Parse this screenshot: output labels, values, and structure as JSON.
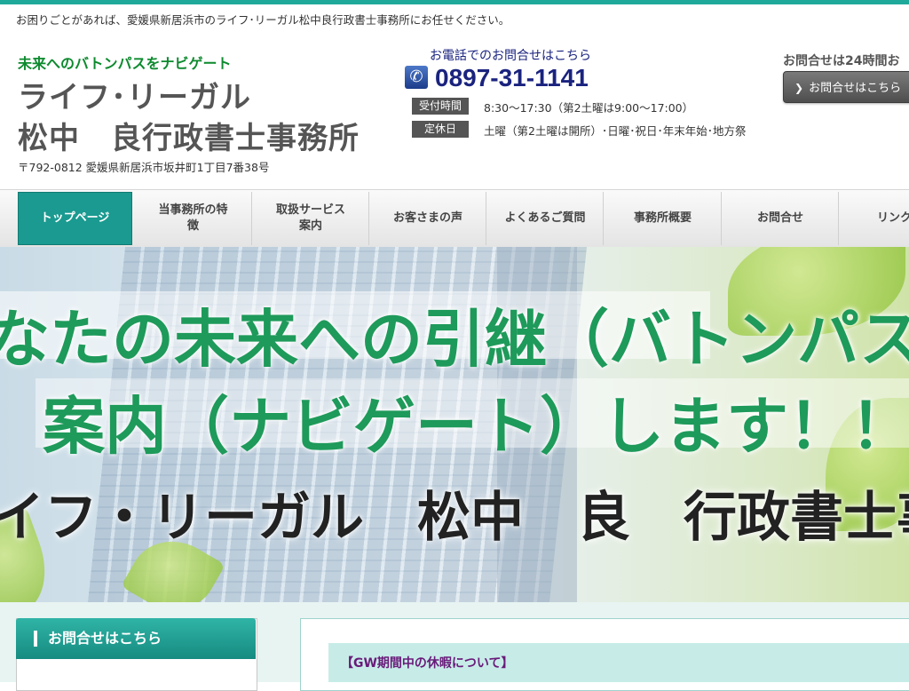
{
  "header": {
    "tagline": "お困りごとがあれば、愛媛県新居浜市のライフ･リーガル松中良行政書士事務所にお任せください。",
    "catchphrase": "未来へのバトンパスをナビゲート",
    "office_name_line1": "ライフ･リーガル",
    "office_name_line2": "松中　良行政書士事務所",
    "address": "〒792-0812 愛媛県新居浜市坂井町1丁目7番38号",
    "tel_caption": "お電話でのお問合せはこちら",
    "tel_number": "0897-31-1141",
    "hours_label": "受付時間",
    "hours_value": "8:30～17:30（第2土曜は9:00～17:00）",
    "closed_label": "定休日",
    "closed_value": "土曜（第2土曜は開所）･日曜･祝日･年末年始･地方祭",
    "contact_24_text": "お問合せは24時間お",
    "contact_button_label": "お問合せはこちら",
    "phone_icon": "phone-icon"
  },
  "nav": {
    "items": [
      {
        "label": "トップページ"
      },
      {
        "label": "当事務所の特徴"
      },
      {
        "label": "取扱サービス案内"
      },
      {
        "label": "お客さまの声"
      },
      {
        "label": "よくあるご質問"
      },
      {
        "label": "事務所概要"
      },
      {
        "label": "お問合せ"
      },
      {
        "label": "リンク集"
      }
    ]
  },
  "hero": {
    "line1": "なたの未来への引継（バトンパス",
    "line2": "案内（ナビゲート）します！！",
    "line3": "イフ・リーガル　松中　良　行政書士事"
  },
  "sidebar": {
    "heading": "お問合せはこちら"
  },
  "main": {
    "news_title": "【GW期間中の休暇について】"
  },
  "colors": {
    "accent": "#1fa99a",
    "nav_active": "#1a9a90",
    "catch_green": "#0d8a2e",
    "tel_navy": "#1a237e",
    "hero_green": "#1e9a5a"
  }
}
